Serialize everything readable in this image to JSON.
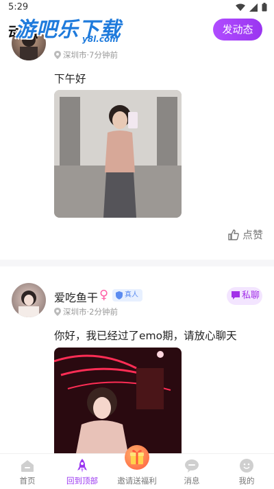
{
  "status_bar": {
    "time": "5:29"
  },
  "header": {
    "title": "动态",
    "post_button": "发动态"
  },
  "watermark": {
    "text": "游吧乐下载",
    "sub": "y8l.com"
  },
  "posts": [
    {
      "location": "深圳市·7分钟前",
      "text": "下午好",
      "like_label": "点赞"
    },
    {
      "name": "爱吃鱼干",
      "badge": "真人",
      "chat_label": "私聊",
      "location": "深圳市·2分钟前",
      "text": "你好，我已经过了emo期，请放心聊天"
    }
  ],
  "tabbar": {
    "items": [
      {
        "label": "首页",
        "icon": "home-icon"
      },
      {
        "label": "回到顶部",
        "icon": "rocket-icon"
      },
      {
        "label": "邀请送福利",
        "icon": "gift-icon"
      },
      {
        "label": "消息",
        "icon": "message-icon"
      },
      {
        "label": "我的",
        "icon": "profile-icon"
      }
    ],
    "active_index": 1
  },
  "colors": {
    "accent": "#9a35f0",
    "badge_blue": "#5b8cf0",
    "female_pink": "#ff5fa6"
  }
}
